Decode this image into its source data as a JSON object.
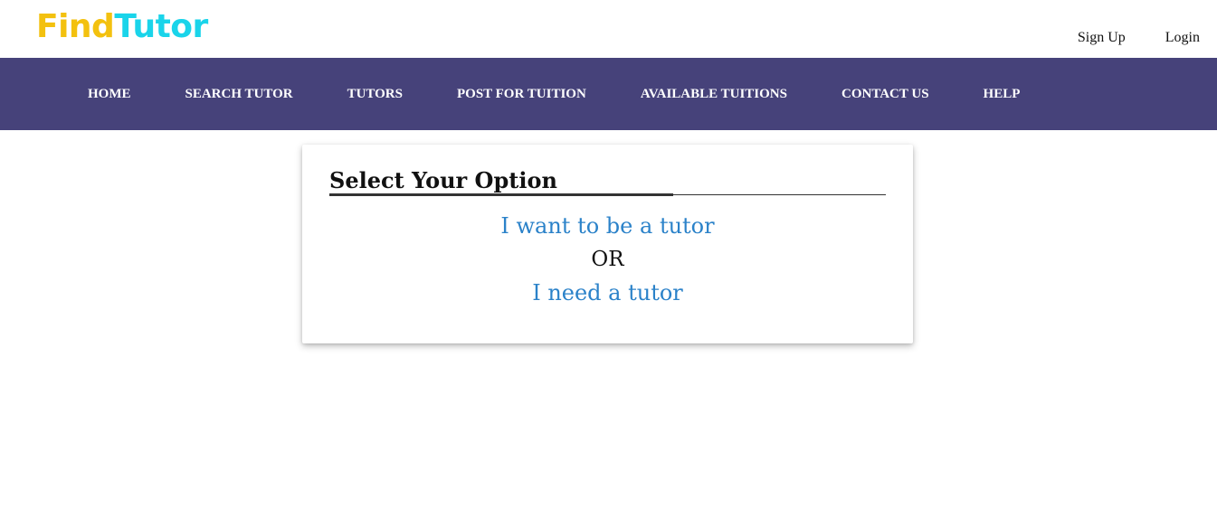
{
  "brand": {
    "logo_part1": "Find",
    "logo_part2": "Tutor",
    "color_part1": "#f3c10f",
    "color_part2": "#1ad4ea"
  },
  "auth": {
    "signup_label": "Sign Up",
    "login_label": "Login"
  },
  "nav": {
    "background": "#46427a",
    "items": [
      {
        "label": "HOME"
      },
      {
        "label": "SEARCH TUTOR"
      },
      {
        "label": "TUTORS"
      },
      {
        "label": "POST FOR TUITION"
      },
      {
        "label": "AVAILABLE TUITIONS"
      },
      {
        "label": "CONTACT US"
      },
      {
        "label": "HELP"
      }
    ]
  },
  "card": {
    "title": "Select Your Option",
    "option_tutor": "I want to be a tutor",
    "separator": "OR",
    "option_student": "I need a tutor",
    "link_color": "#2b82c9"
  }
}
